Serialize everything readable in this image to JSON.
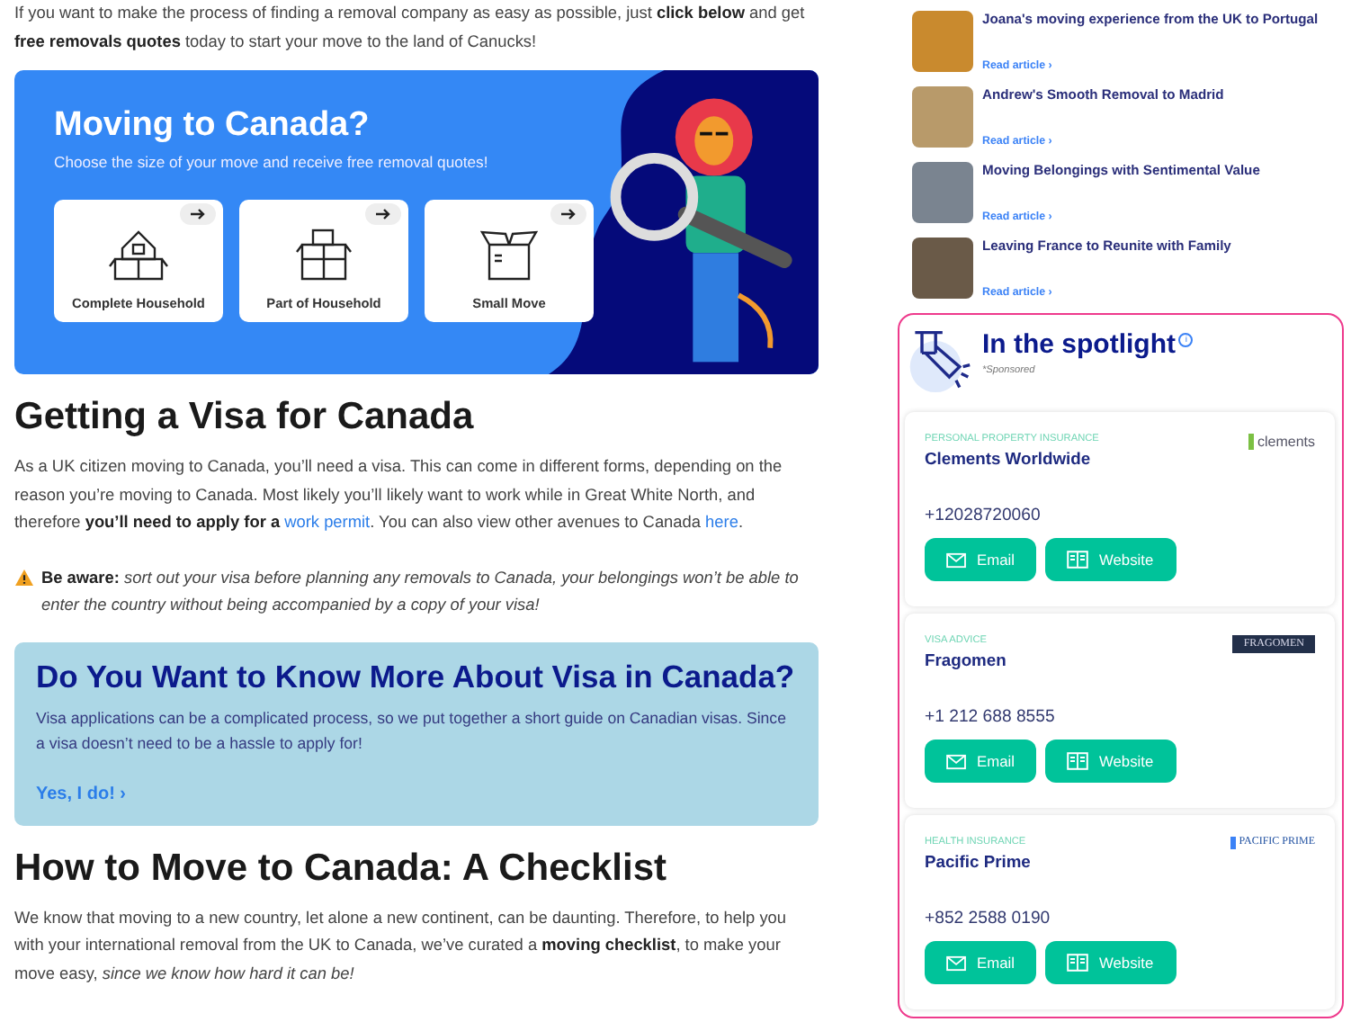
{
  "intro": "If you want to make the process of finding a removal company as easy as possible, just **click below** and get **free removals quotes** today to start your move to the land of Canucks!",
  "banner": {
    "title": "Moving to Canada?",
    "subtitle": "Choose the size of your move and receive free removal quotes!",
    "options": [
      {
        "kind": "house",
        "label": "Complete Household"
      },
      {
        "kind": "boxes",
        "label": "Part of Household"
      },
      {
        "kind": "box",
        "label": "Small Move"
      }
    ]
  },
  "visa": {
    "heading": "Getting a Visa for Canada",
    "paragraph": [
      {
        "kind": "text",
        "text": "As a UK citizen moving to Canada, you’ll need a visa. This can come in different forms, depending on the reason you’re moving to Canada. Most likely you’ll likely want to work while in Great White North, and therefore **you’ll need to apply for a** "
      },
      {
        "kind": "link",
        "text": "work permit"
      },
      {
        "kind": "text",
        "text": ". You can also view other avenues to Canada "
      },
      {
        "kind": "link",
        "text": "here"
      },
      {
        "kind": "text",
        "text": "."
      }
    ],
    "warning": "**Be aware:** *sort out your visa before planning any removals to Canada, your belongings won’t be able to enter the country without being accompanied by a copy of your visa!*"
  },
  "visa_box": {
    "title": "Do You Want to Know More About Visa in Canada?",
    "text": "Visa applications can be a complicated process, so we put together a short guide on Canadian visas. Since a visa doesn’t need to be a hassle to apply for!",
    "link": "Yes, I do! ›"
  },
  "checklist": {
    "heading": "How to Move to Canada: A Checklist",
    "paragraph": "We know that moving to a new country, let alone a new continent, can be daunting. Therefore, to help you with your international removal from the UK to Canada, we’ve curated a **moving checklist**, to make your move easy, *since we know how hard it can be!*"
  },
  "articles": [
    {
      "title": "Joana's moving experience from the UK to Portugal",
      "link": "Read article ›"
    },
    {
      "title": "Andrew's Smooth Removal to Madrid",
      "link": "Read article ›"
    },
    {
      "title": "Moving Belongings with Sentimental Value",
      "link": "Read article ›"
    },
    {
      "title": "Leaving France to Reunite with Family",
      "link": "Read article ›"
    }
  ],
  "spotlight": {
    "title": "In the spotlight",
    "info": "i",
    "sponsored": "*Sponsored",
    "companies": [
      {
        "category": "PERSONAL PROPERTY INSURANCE",
        "name": "Clements Worldwide",
        "logo": {
          "kind": "leaf",
          "text": "clements"
        },
        "phone": "+12028720060",
        "email": "Email",
        "website": "Website"
      },
      {
        "category": "VISA ADVICE",
        "name": "Fragomen",
        "logo": {
          "kind": "dark",
          "text": "FRAGOMEN"
        },
        "phone": "+1 212 688 8555",
        "email": "Email",
        "website": "Website"
      },
      {
        "category": "HEALTH INSURANCE",
        "name": "Pacific Prime",
        "logo": {
          "kind": "star",
          "text": "PACIFIC PRIME"
        },
        "phone": "+852 2588 0190",
        "email": "Email",
        "website": "Website"
      }
    ]
  }
}
